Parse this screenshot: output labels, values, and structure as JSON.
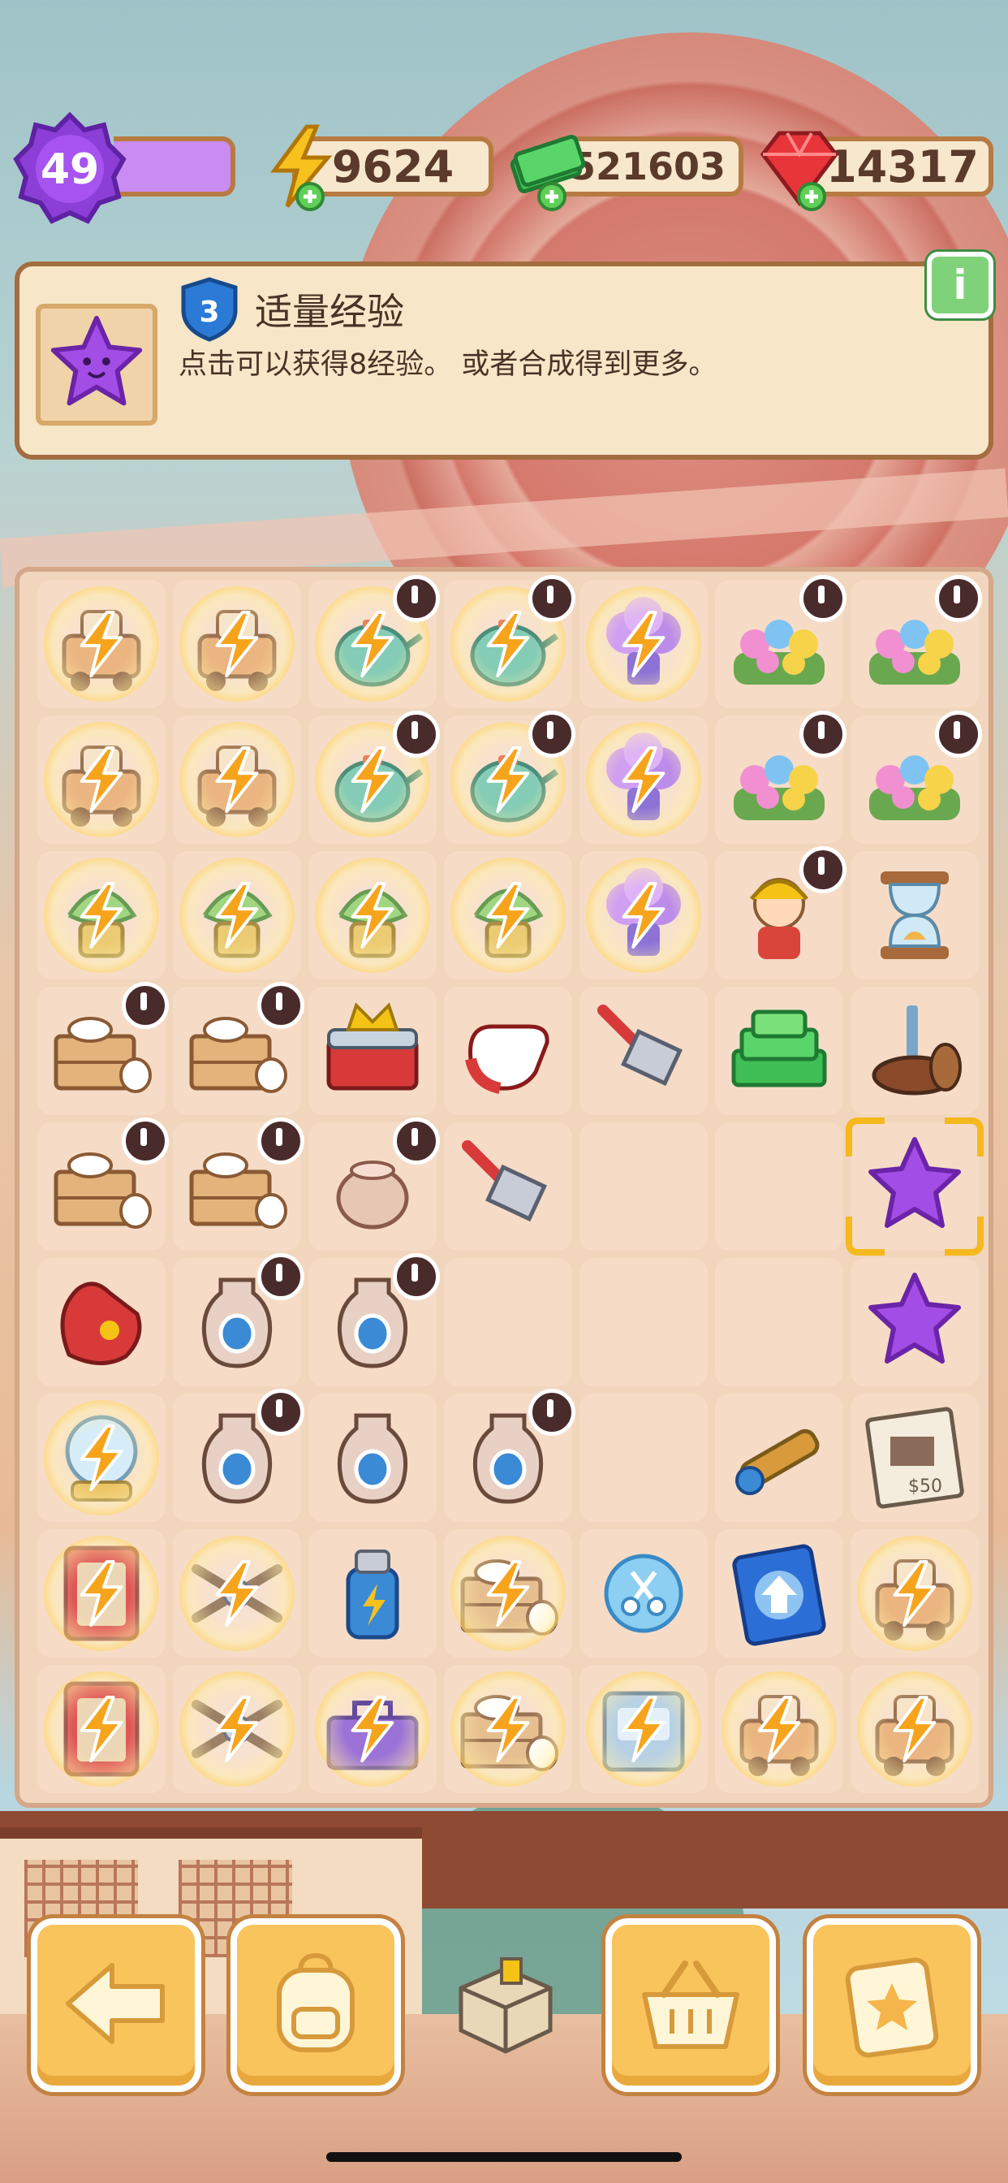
{
  "hud": {
    "level": "49",
    "energy": "9624",
    "cash": "521603",
    "gems": "14317"
  },
  "info_panel": {
    "rank": "3",
    "title": "适量经验",
    "description": "点击可以获得8经验。 或者合成得到更多。",
    "info_button": "i"
  },
  "colors": {
    "accent": "#f9c45c",
    "panel": "#f7e6c8",
    "board": "#f1d6bd",
    "xp": "#c98cf0",
    "selection": "#f5b81d"
  },
  "board": {
    "columns": 7,
    "rows": 9,
    "cells": [
      {
        "name": "noodle-cart",
        "icon": "cart-icon",
        "locked": true,
        "timer": false
      },
      {
        "name": "noodle-cart",
        "icon": "cart-icon",
        "locked": true,
        "timer": false
      },
      {
        "name": "teacup-pot",
        "icon": "teapot-icon",
        "locked": true,
        "timer": true
      },
      {
        "name": "teacup-pot",
        "icon": "teapot-icon",
        "locked": true,
        "timer": true
      },
      {
        "name": "hydrangea-bush",
        "icon": "hydrangea-icon",
        "locked": true,
        "timer": false
      },
      {
        "name": "flower-bed",
        "icon": "flowerbed-icon",
        "locked": false,
        "timer": true
      },
      {
        "name": "flower-bed",
        "icon": "flowerbed-icon",
        "locked": false,
        "timer": true
      },
      {
        "name": "noodle-cart",
        "icon": "cart-icon",
        "locked": true,
        "timer": false
      },
      {
        "name": "noodle-cart",
        "icon": "cart-icon",
        "locked": true,
        "timer": false
      },
      {
        "name": "teacup-pot",
        "icon": "teapot-icon",
        "locked": true,
        "timer": true
      },
      {
        "name": "teacup-pot",
        "icon": "teapot-icon",
        "locked": true,
        "timer": true
      },
      {
        "name": "hydrangea-bush",
        "icon": "hydrangea-icon",
        "locked": true,
        "timer": false
      },
      {
        "name": "flower-bed",
        "icon": "flowerbed-icon",
        "locked": false,
        "timer": true
      },
      {
        "name": "flower-bed",
        "icon": "flowerbed-icon",
        "locked": false,
        "timer": true
      },
      {
        "name": "potted-plant",
        "icon": "plant-icon",
        "locked": true,
        "timer": false
      },
      {
        "name": "potted-plant",
        "icon": "plant-icon",
        "locked": true,
        "timer": false
      },
      {
        "name": "potted-plant",
        "icon": "plant-icon",
        "locked": true,
        "timer": false
      },
      {
        "name": "potted-plant",
        "icon": "plant-icon",
        "locked": true,
        "timer": false
      },
      {
        "name": "hydrangea-bush",
        "icon": "hydrangea-icon",
        "locked": true,
        "timer": false
      },
      {
        "name": "shopkeeper",
        "icon": "character-icon",
        "locked": false,
        "timer": true
      },
      {
        "name": "hourglass",
        "icon": "hourglass-icon",
        "locked": false,
        "timer": false
      },
      {
        "name": "pottery-crate",
        "icon": "crate-icon",
        "locked": false,
        "timer": true
      },
      {
        "name": "pottery-crate",
        "icon": "crate-icon",
        "locked": false,
        "timer": true
      },
      {
        "name": "crown-chest",
        "icon": "chest-icon",
        "locked": false,
        "timer": false
      },
      {
        "name": "work-glove",
        "icon": "glove-icon",
        "locked": false,
        "timer": false
      },
      {
        "name": "garden-rake",
        "icon": "rake-icon",
        "locked": false,
        "timer": false
      },
      {
        "name": "cash-pile",
        "icon": "cash-icon",
        "locked": false,
        "timer": false
      },
      {
        "name": "log-stump",
        "icon": "stump-icon",
        "locked": false,
        "timer": false
      },
      {
        "name": "pottery-crate",
        "icon": "crate-icon",
        "locked": false,
        "timer": true
      },
      {
        "name": "pottery-crate",
        "icon": "crate-icon",
        "locked": false,
        "timer": true
      },
      {
        "name": "clay-pot",
        "icon": "pot-icon",
        "locked": false,
        "timer": true
      },
      {
        "name": "garden-rake",
        "icon": "rake-icon",
        "locked": false,
        "timer": false
      },
      {
        "name": "empty",
        "icon": "",
        "locked": false,
        "timer": false
      },
      {
        "name": "empty",
        "icon": "",
        "locked": false,
        "timer": false
      },
      {
        "name": "purple-star-selected",
        "icon": "star-icon",
        "locked": false,
        "timer": false,
        "selected": true
      },
      {
        "name": "baseball-glove",
        "icon": "mitt-icon",
        "locked": false,
        "timer": false
      },
      {
        "name": "painted-vase",
        "icon": "vase-icon",
        "locked": false,
        "timer": true
      },
      {
        "name": "white-vase",
        "icon": "vase-icon",
        "locked": false,
        "timer": true
      },
      {
        "name": "empty",
        "icon": "",
        "locked": false,
        "timer": false
      },
      {
        "name": "empty",
        "icon": "",
        "locked": false,
        "timer": false
      },
      {
        "name": "empty",
        "icon": "",
        "locked": false,
        "timer": false
      },
      {
        "name": "purple-star",
        "icon": "star-icon",
        "locked": false,
        "timer": false
      },
      {
        "name": "snow-globe",
        "icon": "globe-icon",
        "locked": true,
        "timer": false
      },
      {
        "name": "blue-vase",
        "icon": "vase-icon",
        "locked": false,
        "timer": true
      },
      {
        "name": "slim-vase",
        "icon": "vase-icon",
        "locked": false,
        "timer": false
      },
      {
        "name": "striped-vase",
        "icon": "vase-icon",
        "locked": false,
        "timer": true
      },
      {
        "name": "empty",
        "icon": "",
        "locked": false,
        "timer": false
      },
      {
        "name": "spyglass",
        "icon": "telescope-icon",
        "locked": false,
        "timer": false
      },
      {
        "name": "wanted-poster",
        "icon": "poster-icon",
        "locked": false,
        "timer": false
      },
      {
        "name": "red-cabinet",
        "icon": "cabinet-icon",
        "locked": true,
        "timer": false
      },
      {
        "name": "tools",
        "icon": "tools-icon",
        "locked": true,
        "timer": false
      },
      {
        "name": "energy-bottle",
        "icon": "bottle-icon",
        "locked": false,
        "timer": false
      },
      {
        "name": "crate-stack",
        "icon": "crate-icon",
        "locked": true,
        "timer": false
      },
      {
        "name": "scissors-token",
        "icon": "scissors-icon",
        "locked": false,
        "timer": false
      },
      {
        "name": "upgrade-card",
        "icon": "upgrade-icon",
        "locked": false,
        "timer": false
      },
      {
        "name": "cart-flowers",
        "icon": "cart-icon",
        "locked": true,
        "timer": false
      },
      {
        "name": "red-cabinet",
        "icon": "cabinet-icon",
        "locked": true,
        "timer": false
      },
      {
        "name": "tools",
        "icon": "tools-icon",
        "locked": true,
        "timer": false
      },
      {
        "name": "toolbox",
        "icon": "toolbox-icon",
        "locked": true,
        "timer": false
      },
      {
        "name": "crate-stack",
        "icon": "crate-icon",
        "locked": true,
        "timer": false
      },
      {
        "name": "machine",
        "icon": "machine-icon",
        "locked": true,
        "timer": false
      },
      {
        "name": "flower-cart",
        "icon": "cart-icon",
        "locked": true,
        "timer": false
      },
      {
        "name": "flower-cart",
        "icon": "cart-icon",
        "locked": true,
        "timer": false
      }
    ]
  },
  "toolbar": {
    "buttons": [
      {
        "name": "back-button",
        "icon": "arrow-left-icon"
      },
      {
        "name": "backpack-button",
        "icon": "backpack-icon"
      },
      {
        "name": "supply-box-button",
        "icon": "box-icon"
      },
      {
        "name": "shop-basket-button",
        "icon": "basket-icon"
      },
      {
        "name": "tasks-button",
        "icon": "clipboard-star-icon"
      }
    ]
  }
}
